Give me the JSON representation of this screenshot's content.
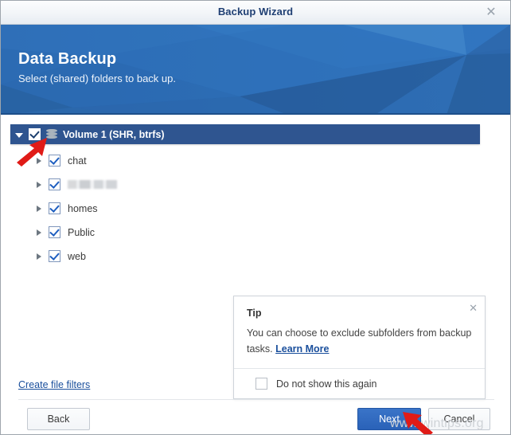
{
  "window": {
    "title": "Backup Wizard",
    "close_icon": "close-icon",
    "close_glyph": "✕"
  },
  "hero": {
    "title": "Data Backup",
    "subtitle": "Select (shared) folders to back up."
  },
  "tree": {
    "volume": {
      "label": "Volume 1 (SHR, btrfs)",
      "checked": true,
      "expanded": true,
      "icon": "disk-stack-icon"
    },
    "children": [
      {
        "label": "chat",
        "checked": true,
        "redacted": false
      },
      {
        "label": "",
        "checked": true,
        "redacted": true
      },
      {
        "label": "homes",
        "checked": true,
        "redacted": false
      },
      {
        "label": "Public",
        "checked": true,
        "redacted": false
      },
      {
        "label": "web",
        "checked": true,
        "redacted": false
      }
    ]
  },
  "tip": {
    "title": "Tip",
    "text_before_link": "You can choose to exclude subfolders from backup tasks. ",
    "link_label": "Learn More",
    "close_glyph": "✕",
    "dont_show_label": "Do not show this again",
    "dont_show_checked": false
  },
  "links": {
    "create_file_filters": "Create file filters"
  },
  "footer": {
    "back_label": "Back",
    "next_label": "Next",
    "cancel_label": "Cancel"
  },
  "watermark": {
    "text": "www.wintips.org"
  },
  "colors": {
    "accent_blue": "#2a62b8",
    "selected_row": "#2f5590",
    "hero_blue": "#2c6cb5",
    "link_blue": "#1a4f9c",
    "annotation_red": "#e01b17"
  }
}
